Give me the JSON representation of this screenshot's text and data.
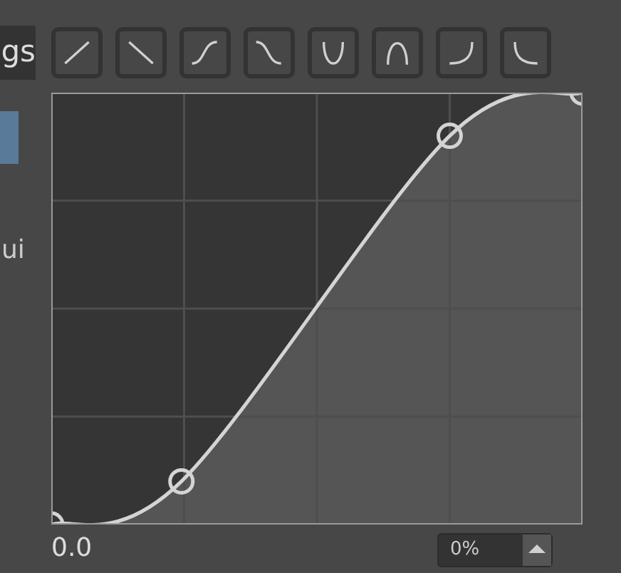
{
  "tab": {
    "label": "gs"
  },
  "side_label": "ui",
  "value_label": "0.0",
  "spinbox": {
    "value": "0%"
  }
}
